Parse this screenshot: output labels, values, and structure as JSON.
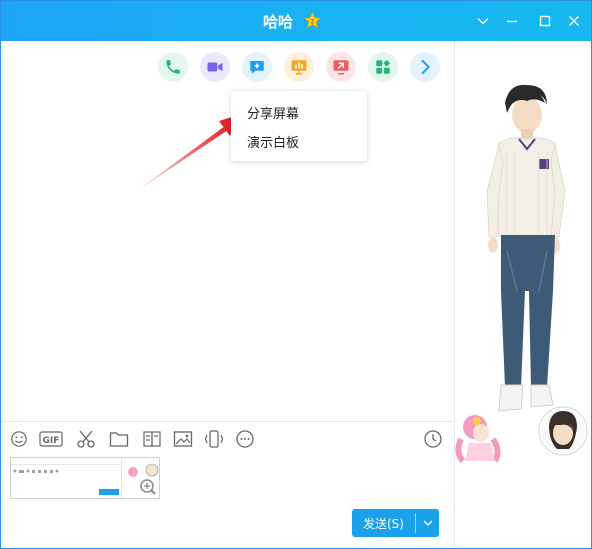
{
  "window": {
    "title": "哈哈",
    "controls": [
      "chevron-down-icon",
      "minimize-icon",
      "maximize-icon",
      "close-icon"
    ]
  },
  "toolbar_top": {
    "buttons": [
      {
        "icon": "phone-icon",
        "color": "#22b573"
      },
      {
        "icon": "video-icon",
        "color": "#7a62e8"
      },
      {
        "icon": "message-plus-icon",
        "color": "#1ea0f0"
      },
      {
        "icon": "presentation-icon",
        "color": "#f5a623"
      },
      {
        "icon": "screen-share-icon",
        "color": "#ef5c5c"
      },
      {
        "icon": "apps-icon",
        "color": "#22b573"
      },
      {
        "icon": "chevron-right-icon",
        "color": "#1ea0f0"
      }
    ]
  },
  "popup_menu": {
    "items": [
      "分享屏幕",
      "演示白板"
    ]
  },
  "input_toolbar": {
    "tools": [
      "emoji-icon",
      "gif-icon",
      "scissors-icon",
      "folder-icon",
      "sticker-icon",
      "image-icon",
      "shake-icon",
      "more-icon",
      "history-icon"
    ],
    "gif_label": "GIF"
  },
  "send": {
    "label": "发送(S)"
  },
  "colors": {
    "accent": "#1aa1ea",
    "titlebar": "#18b2f2",
    "arrow": "#e0252b"
  }
}
